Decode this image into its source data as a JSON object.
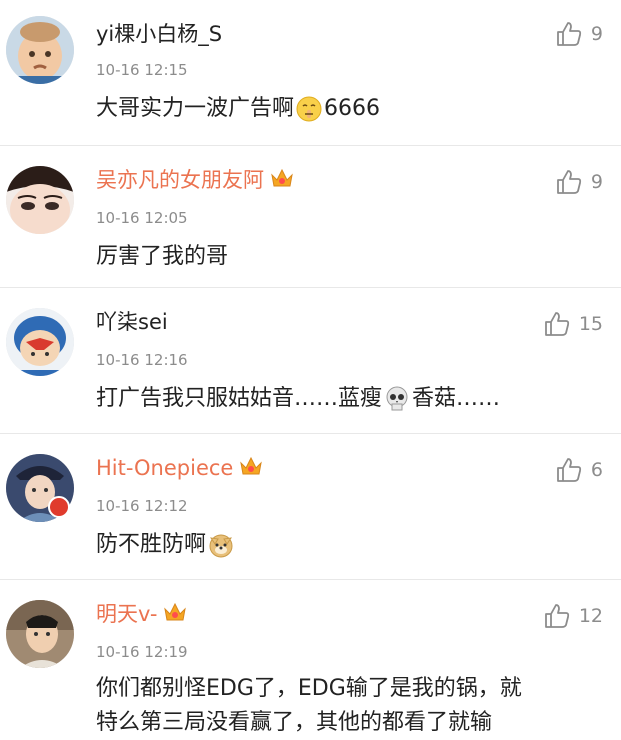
{
  "comments": [
    {
      "username": "yi棵小白杨_S",
      "time": "10-16 12:15",
      "text_before": "大哥实力一波广告啊",
      "emoji": "shush-face-emoji",
      "text_after": "6666",
      "likes": "9",
      "vip": false
    },
    {
      "username": "吴亦凡的女朋友阿",
      "time": "10-16 12:05",
      "text": "厉害了我的哥",
      "likes": "9",
      "vip": true
    },
    {
      "username": "吖柒sei",
      "time": "10-16 12:16",
      "text_part1": "打广告我只服姑姑音……蓝瘦",
      "emoji": "skull-emoji",
      "text_part2": "香菇……",
      "likes": "15",
      "vip": false
    },
    {
      "username": "Hit-Onepiece",
      "time": "10-16 12:12",
      "text": "防不胜防啊",
      "emoji": "doge-emoji",
      "likes": "6",
      "vip": true
    },
    {
      "username": "明天v-",
      "time": "10-16 12:19",
      "line1": "你们都别怪EDG了，EDG输了是我的锅，就",
      "line2": "特么第三局没看赢了，其他的都看了就输",
      "likes": "12",
      "vip": true
    }
  ],
  "colors": {
    "vip_name": "#eb7350",
    "normal_name": "#222222",
    "meta": "#8c8c8c",
    "crown": "#f5a623"
  },
  "icons": {
    "like": "thumbs-up-icon",
    "vip": "crown-icon"
  }
}
